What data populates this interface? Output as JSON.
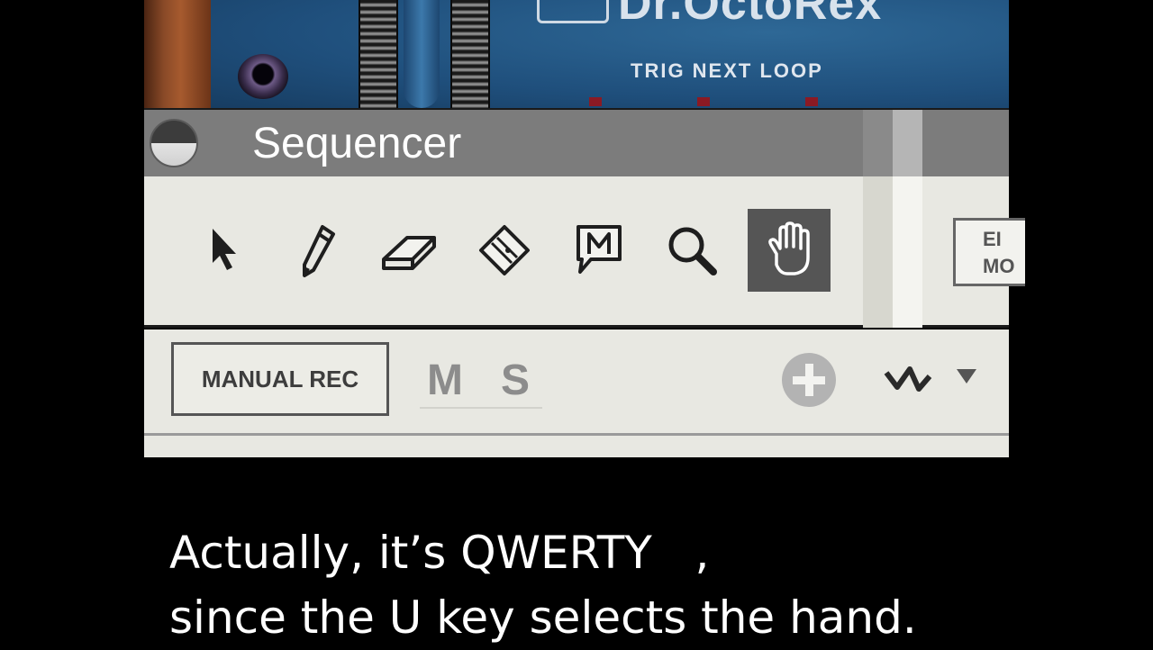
{
  "rack": {
    "logo": "Dr.OctoRex",
    "trig_label": "TRIG NEXT LOOP",
    "led_color": "#8b1a24"
  },
  "sequencer": {
    "title": "Sequencer",
    "tools": [
      {
        "name": "arrow-tool-icon",
        "active": false
      },
      {
        "name": "pencil-tool-icon",
        "active": false
      },
      {
        "name": "eraser-tool-icon",
        "active": false
      },
      {
        "name": "razor-tool-icon",
        "active": false
      },
      {
        "name": "mute-tool-icon",
        "active": false
      },
      {
        "name": "magnify-tool-icon",
        "active": true
      },
      {
        "name": "hand-tool-icon",
        "active": true
      }
    ],
    "edit_mode_label_line1": "EI",
    "edit_mode_label_line2": "MO"
  },
  "track": {
    "manual_rec_label": "MANUAL REC",
    "mute_label": "M",
    "solo_label": "S"
  },
  "caption": {
    "line1": "Actually, it’s QWERTY   ,",
    "line2": "since the U key selects the hand."
  },
  "colors": {
    "accent_active_tool": "#555555",
    "panel_bg": "#e8e8e2",
    "titlebar_bg": "#7c7c7c",
    "rack_blue": "#24517a"
  }
}
